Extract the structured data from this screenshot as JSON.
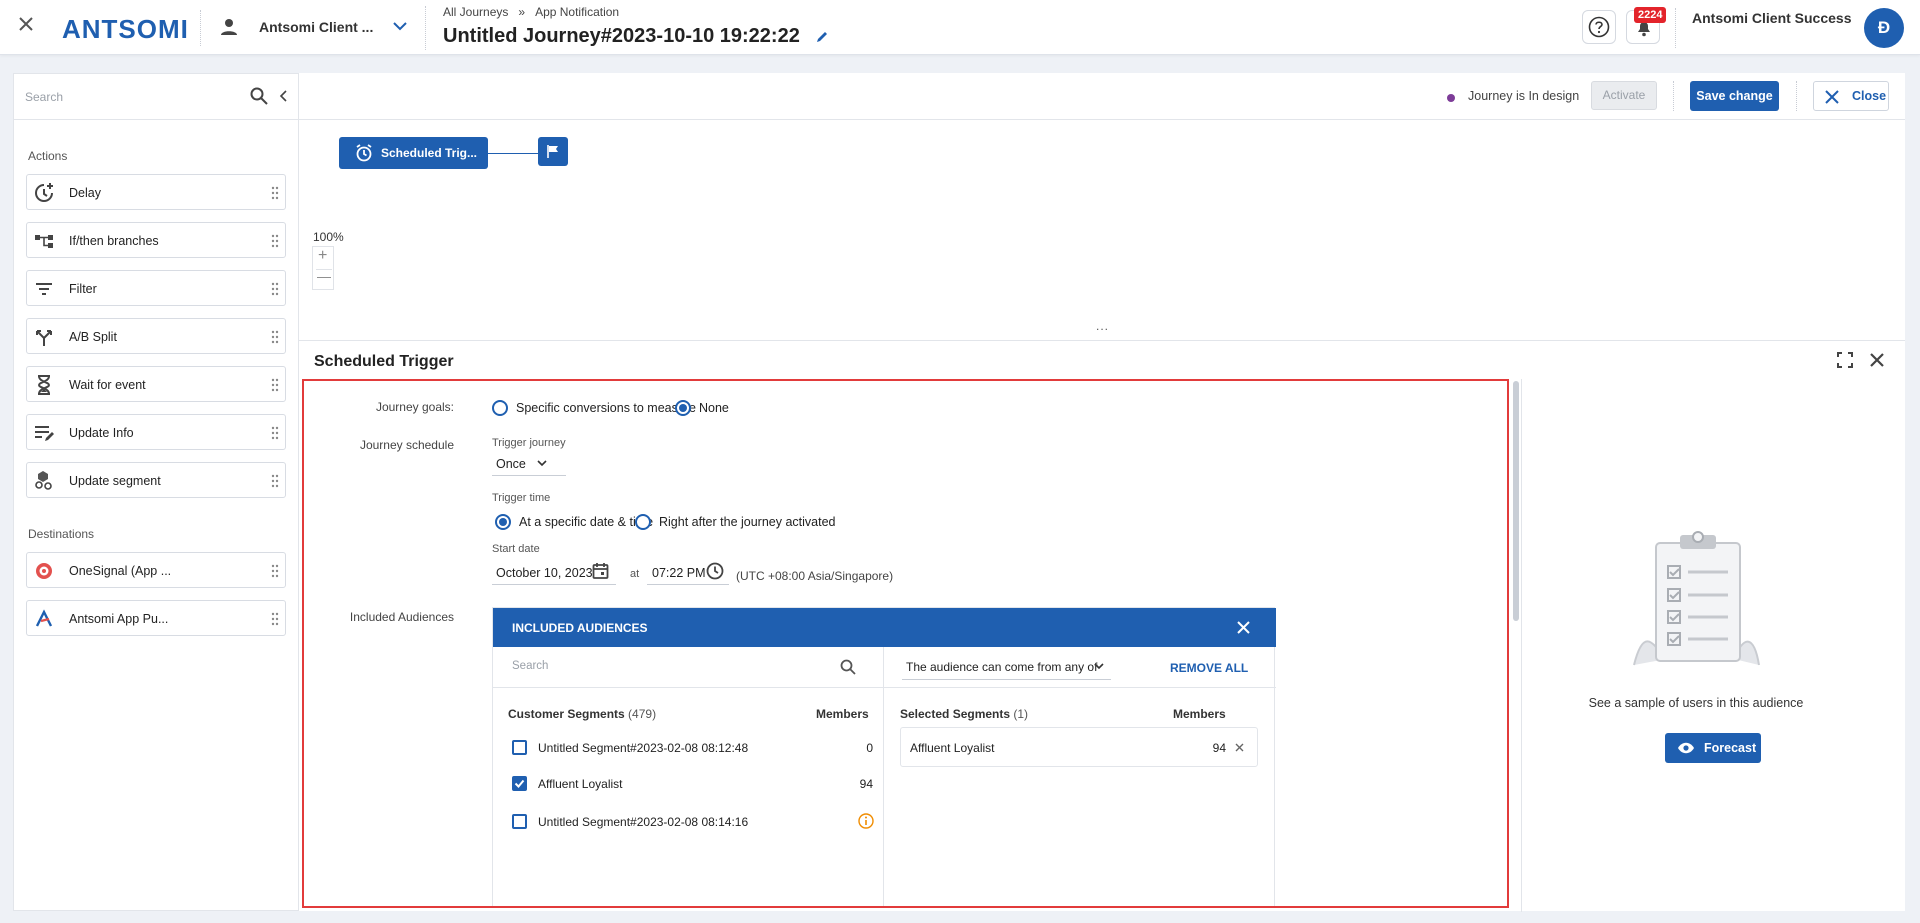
{
  "header": {
    "logo": "ANTSOMI",
    "portal_name": "Antsomi Client ...",
    "breadcrumb": [
      "All Journeys",
      "»",
      "App Notification"
    ],
    "journey_title": "Untitled Journey#2023-10-10 19:22:22",
    "notification_count": "2224",
    "user_name": "Antsomi Client Success",
    "avatar_letter": "Đ"
  },
  "sidebar": {
    "search_placeholder": "Search",
    "actions_label": "Actions",
    "actions": [
      {
        "label": "Delay",
        "icon": "delay-icon"
      },
      {
        "label": "If/then branches",
        "icon": "branches-icon"
      },
      {
        "label": "Filter",
        "icon": "filter-icon"
      },
      {
        "label": "A/B Split",
        "icon": "split-icon"
      },
      {
        "label": "Wait for event",
        "icon": "hourglass-icon"
      },
      {
        "label": "Update Info",
        "icon": "edit-lines-icon"
      },
      {
        "label": "Update segment",
        "icon": "segment-icon"
      }
    ],
    "destinations_label": "Destinations",
    "destinations": [
      {
        "label": "OneSignal (App ...",
        "icon": "onesignal-icon",
        "color": "#e3514e"
      },
      {
        "label": "Antsomi App Pu...",
        "icon": "antsomi-icon",
        "color": "#1f5fb0"
      }
    ]
  },
  "canvas": {
    "status_text": "Journey is In design",
    "status_color": "#7d3c98",
    "activate_label": "Activate",
    "save_label": "Save change",
    "close_label": "Close",
    "node_label": "Scheduled Trig...",
    "zoom": "100%",
    "zoom_in": "+",
    "zoom_out": "—",
    "handle": "..."
  },
  "drawer": {
    "title": "Scheduled Trigger",
    "journey_goals_label": "Journey goals:",
    "goal_options": [
      "Specific conversions to measure",
      "None"
    ],
    "goal_selected": "None",
    "journey_schedule_label": "Journey schedule",
    "trigger_journey_label": "Trigger journey",
    "trigger_journey_value": "Once",
    "trigger_time_label": "Trigger time",
    "time_options": [
      "At a specific date & time",
      "Right after the journey activated"
    ],
    "time_selected": "At a specific date & time",
    "start_date_label": "Start date",
    "start_date": "October 10, 2023",
    "at": "at",
    "start_time": "07:22 PM",
    "timezone": "(UTC +08:00 Asia/Singapore)",
    "included_audiences_label": "Included Audiences",
    "audiences": {
      "header": "INCLUDED AUDIENCES",
      "search_placeholder": "Search",
      "mode": "The audience can come from any of",
      "remove_all": "REMOVE ALL",
      "customer_segments_label": "Customer Segments",
      "customer_segments_count": "(479)",
      "members_label": "Members",
      "segments": [
        {
          "name": "Untitled Segment#2023-02-08 08:12:48",
          "members": "0",
          "checked": false
        },
        {
          "name": "Affluent Loyalist",
          "members": "94",
          "checked": true
        },
        {
          "name": "Untitled Segment#2023-02-08 08:14:16",
          "members": "",
          "checked": false,
          "warning": true
        }
      ],
      "selected_segments_label": "Selected Segments",
      "selected_segments_count": "(1)",
      "selected": [
        {
          "name": "Affluent Loyalist",
          "members": "94"
        }
      ]
    },
    "forecast_text": "See a sample of users in this audience",
    "forecast_button": "Forecast"
  }
}
